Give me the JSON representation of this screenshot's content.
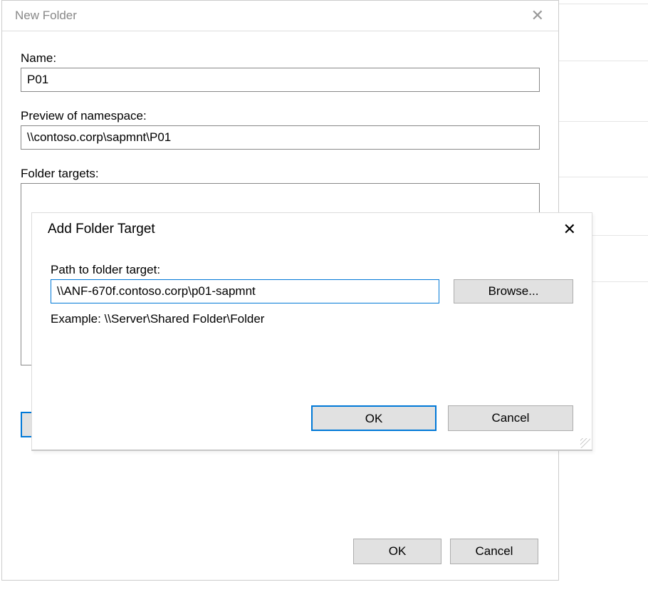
{
  "newFolder": {
    "title": "New Folder",
    "nameLabel": "Name:",
    "nameValue": "P01",
    "previewLabel": "Preview of namespace:",
    "previewValue": "\\\\contoso.corp\\sapmnt\\P01",
    "targetsLabel": "Folder targets:",
    "ok": "OK",
    "cancel": "Cancel"
  },
  "addTarget": {
    "title": "Add Folder Target",
    "pathLabel": "Path to folder target:",
    "pathValue": "\\\\ANF-670f.contoso.corp\\p01-sapmnt",
    "browse": "Browse...",
    "example": "Example: \\\\Server\\Shared Folder\\Folder",
    "ok": "OK",
    "cancel": "Cancel"
  }
}
